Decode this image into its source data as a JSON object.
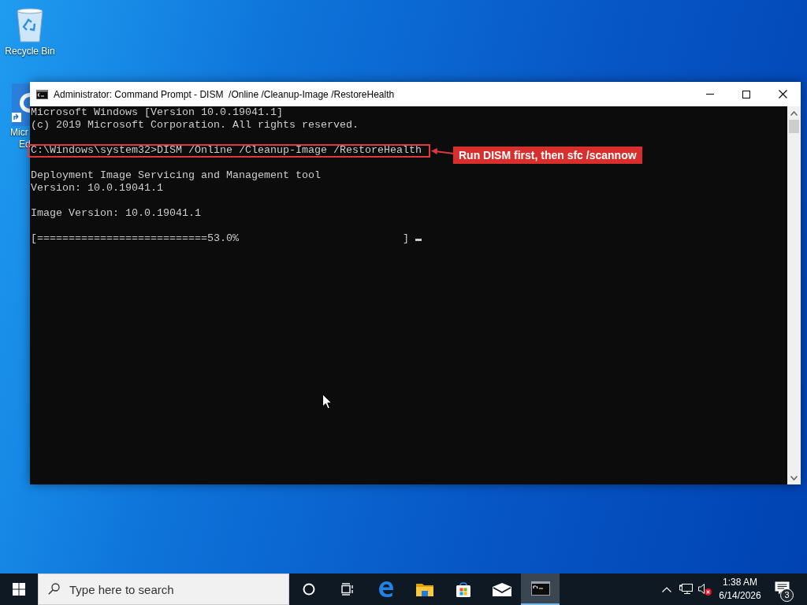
{
  "desktop_icons": [
    {
      "label": [
        "Recycle Bin"
      ]
    },
    {
      "label": [
        "Micr",
        "Ed"
      ]
    }
  ],
  "window": {
    "title": "Administrator: Command Prompt - DISM  /Online /Cleanup-Image /RestoreHealth",
    "console": {
      "blocks": [
        [
          {
            "text": "Microsoft Windows [Version 10.0.19041.1]",
            "highlighted": false
          },
          {
            "text": "(c) 2019 Microsoft Corporation. All rights reserved.",
            "highlighted": false
          }
        ],
        [
          {
            "text": "C:\\Windows\\system32>DISM /Online /Cleanup-Image /RestoreHealth",
            "highlighted": true
          }
        ],
        [
          {
            "text": "Deployment Image Servicing and Management tool",
            "highlighted": false
          },
          {
            "text": "Version: 10.0.19041.1",
            "highlighted": false
          }
        ],
        [
          {
            "text": "Image Version: 10.0.19041.1",
            "highlighted": false
          }
        ],
        [
          {
            "text": "[===========================53.0%                          ]",
            "highlighted": false
          }
        ]
      ]
    },
    "annotation": {
      "text": "Run DISM first, then sfc /scannow"
    }
  },
  "taskbar": {
    "search": {
      "placeholder": "Type here to search"
    },
    "apps": [
      {
        "selected": false
      },
      {
        "selected": false
      },
      {
        "selected": false
      },
      {
        "selected": false
      },
      {
        "selected": false
      },
      {
        "selected": false
      },
      {
        "selected": true
      }
    ],
    "clock": {
      "time": "1:38 AM",
      "date": "6/14/2026"
    },
    "notifications": {
      "count": "3"
    }
  }
}
